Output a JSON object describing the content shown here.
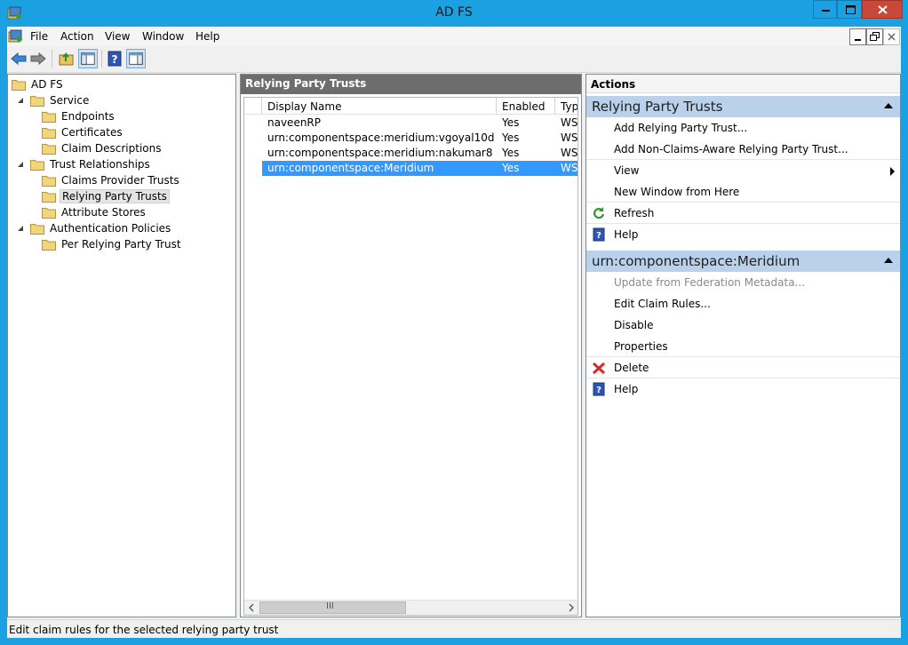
{
  "window": {
    "title": "AD FS"
  },
  "menu": {
    "items": [
      "File",
      "Action",
      "View",
      "Window",
      "Help"
    ]
  },
  "tree": {
    "items": [
      {
        "label": "AD FS",
        "level": 0,
        "expander": "none",
        "icon": "folder-icon"
      },
      {
        "label": "Service",
        "level": 1,
        "expander": "expanded",
        "icon": "folder-icon"
      },
      {
        "label": "Endpoints",
        "level": 2,
        "expander": "none",
        "icon": "folder-icon"
      },
      {
        "label": "Certificates",
        "level": 2,
        "expander": "none",
        "icon": "folder-icon"
      },
      {
        "label": "Claim Descriptions",
        "level": 2,
        "expander": "none",
        "icon": "folder-icon"
      },
      {
        "label": "Trust Relationships",
        "level": 1,
        "expander": "expanded",
        "icon": "folder-icon"
      },
      {
        "label": "Claims Provider Trusts",
        "level": 2,
        "expander": "none",
        "icon": "folder-icon"
      },
      {
        "label": "Relying Party Trusts",
        "level": 2,
        "expander": "none",
        "icon": "folder-icon",
        "selected": true
      },
      {
        "label": "Attribute Stores",
        "level": 2,
        "expander": "none",
        "icon": "folder-icon"
      },
      {
        "label": "Authentication Policies",
        "level": 1,
        "expander": "expanded",
        "icon": "folder-icon"
      },
      {
        "label": "Per Relying Party Trust",
        "level": 2,
        "expander": "none",
        "icon": "folder-icon"
      }
    ]
  },
  "center": {
    "title": "Relying Party Trusts",
    "columns": [
      "Display Name",
      "Enabled",
      "Type"
    ],
    "rows": [
      {
        "name": "naveenRP",
        "enabled": "Yes",
        "type": "WS-"
      },
      {
        "name": "urn:componentspace:meridium:vgoyal10d",
        "enabled": "Yes",
        "type": "WS-"
      },
      {
        "name": "urn:componentspace:meridium:nakumar8",
        "enabled": "Yes",
        "type": "WS-"
      },
      {
        "name": "urn:componentspace:Meridium",
        "enabled": "Yes",
        "type": "WS-",
        "selected": true
      }
    ],
    "scroll_thumb_glyph": "III"
  },
  "actions": {
    "title": "Actions",
    "sections": [
      {
        "heading": "Relying Party Trusts",
        "items": [
          {
            "label": "Add Relying Party Trust...",
            "icon": "none"
          },
          {
            "label": "Add Non-Claims-Aware Relying Party Trust...",
            "icon": "none"
          },
          {
            "label": "View",
            "icon": "none",
            "submenu": true
          },
          {
            "label": "New Window from Here",
            "icon": "none"
          },
          {
            "label": "Refresh",
            "icon": "refresh-icon"
          },
          {
            "label": "Help",
            "icon": "help-icon"
          }
        ]
      },
      {
        "heading": "urn:componentspace:Meridium",
        "items": [
          {
            "label": "Update from Federation Metadata...",
            "icon": "none",
            "disabled": true
          },
          {
            "label": "Edit Claim Rules...",
            "icon": "none"
          },
          {
            "label": "Disable",
            "icon": "none"
          },
          {
            "label": "Properties",
            "icon": "none"
          },
          {
            "label": "Delete",
            "icon": "delete-icon"
          },
          {
            "label": "Help",
            "icon": "help-icon"
          }
        ]
      }
    ]
  },
  "status": {
    "text": "Edit claim rules for the selected relying party trust"
  },
  "colors": {
    "title_bar": "#1ba1e2",
    "close_button": "#c7493a",
    "selection": "#3399ff",
    "section_header": "#b9d1ea",
    "pane_header": "#6d6d6d"
  }
}
